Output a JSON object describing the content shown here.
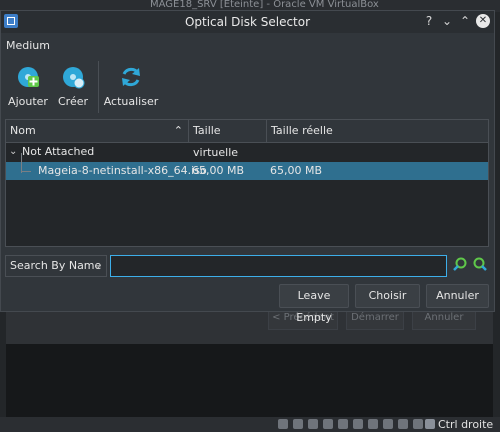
{
  "background_window": {
    "title": "MAGE18_SRV [Éteinte] - Oracle VM VirtualBox",
    "buttons": [
      "< Précédent",
      "Démarrer",
      "Annuler"
    ],
    "statusbar_text": "Ctrl droite"
  },
  "dialog": {
    "title": "Optical Disk Selector",
    "controls": {
      "help": "?",
      "minimize": "⌄",
      "maximize": "⌃",
      "close": "✕"
    },
    "medium_label": "Medium",
    "toolbar": {
      "add_label": "Ajouter",
      "create_label": "Créer",
      "refresh_label": "Actualiser"
    },
    "table": {
      "columns": [
        "Nom",
        "Taille virtuelle",
        "Taille réelle"
      ],
      "group_label": "Not Attached",
      "rows": [
        {
          "name": "Mageia-8-netinstall-x86_64.iso",
          "virtual_size": "65,00 MB",
          "actual_size": "65,00 MB"
        }
      ]
    },
    "search": {
      "mode": "Search By Name",
      "value": ""
    },
    "buttons": {
      "leave_empty": "Leave Empty",
      "choose": "Choisir",
      "cancel": "Annuler"
    }
  },
  "colors": {
    "accent": "#3daee9",
    "selection": "#2f6f8f",
    "dialog_bg": "#31363b",
    "tool_icon": "#2fa8d8",
    "add_plus": "#5fc84a"
  },
  "icons": [
    "add-disk-icon",
    "create-disk-icon",
    "refresh-icon",
    "search-prev-icon",
    "search-next-icon"
  ]
}
